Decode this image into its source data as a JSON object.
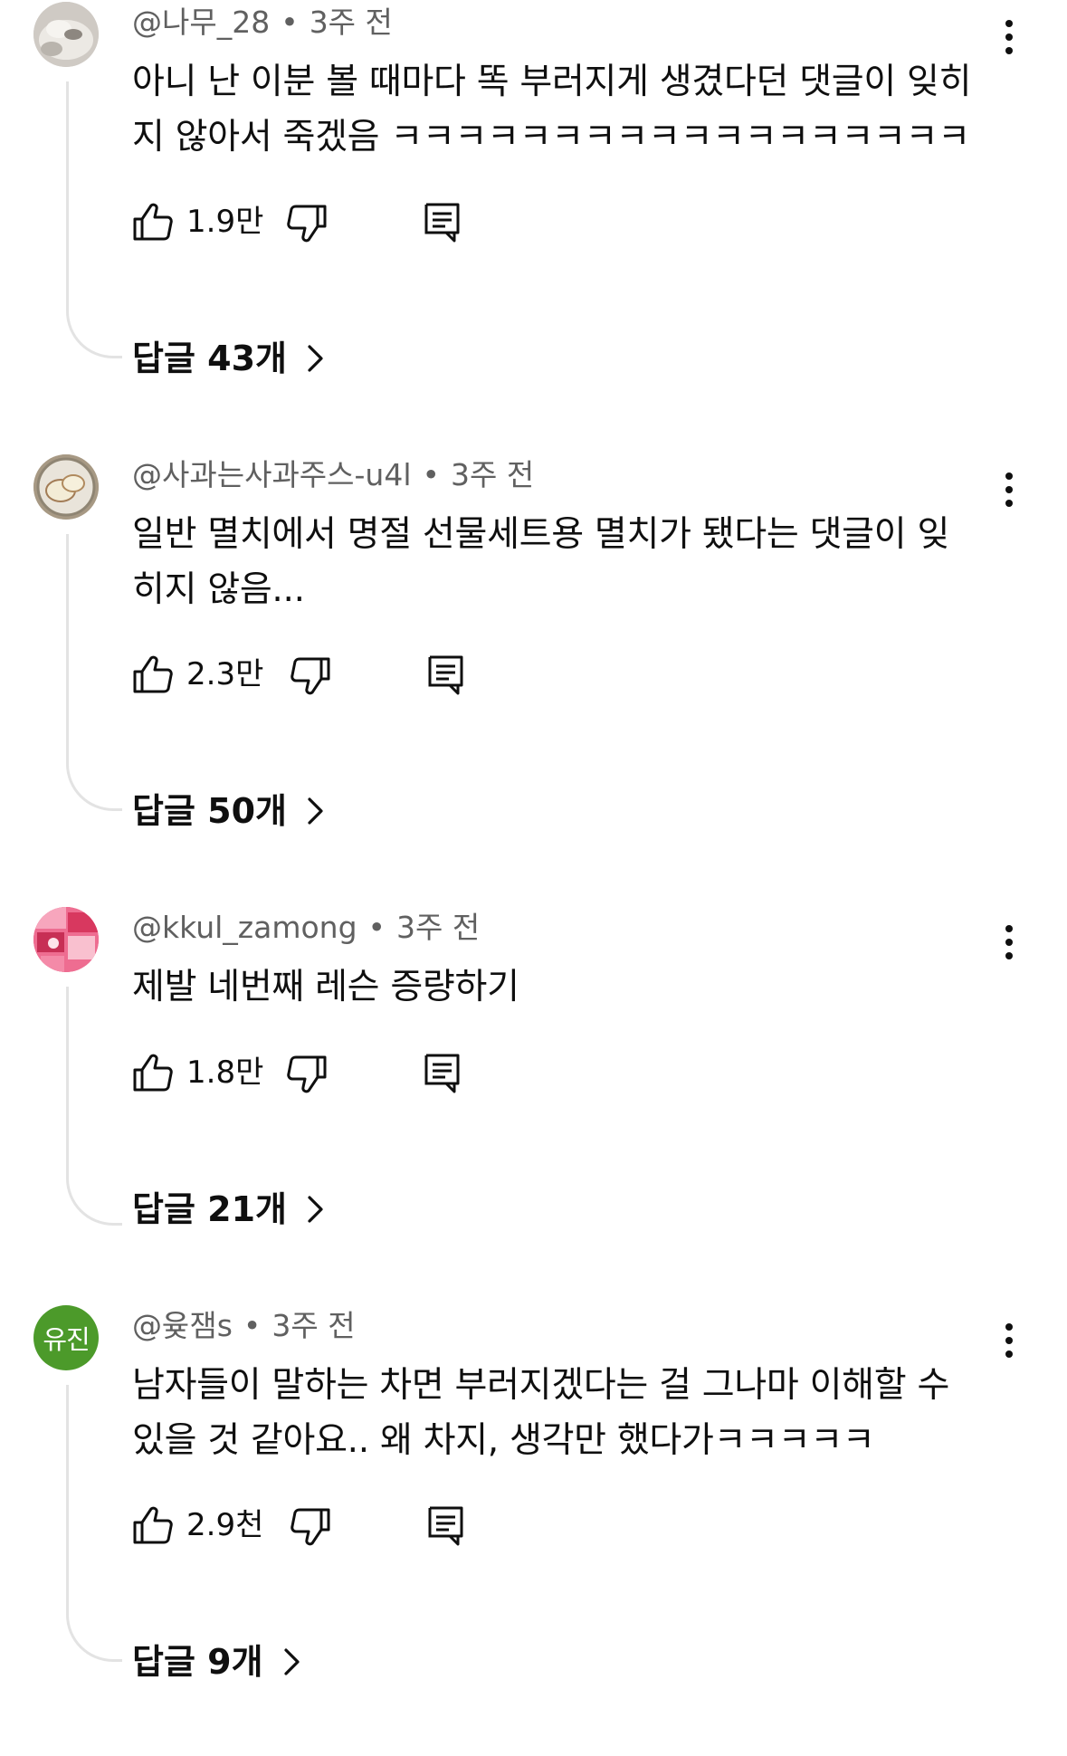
{
  "comments": [
    {
      "author": "@나무_28",
      "time": "3주 전",
      "text_lines": [
        "아니 난 이분 볼 때마다 똑 부러지게 생겼다던 댓글이 잊히",
        "지 않아서 죽겠음 ㅋㅋㅋㅋㅋㅋㅋㅋㅋㅋㅋㅋㅋㅋㅋㅋㅋㅋ"
      ],
      "likes": "1.9만",
      "replies_label": "답글 43개",
      "avatar_icon": "sleeping-cat-photo"
    },
    {
      "author": "@사과는사과주스-u4l",
      "time": "3주 전",
      "text_lines": [
        "일반 멸치에서 명절 선물세트용 멸치가 됐다는 댓글이 잊",
        "히지 않음..."
      ],
      "likes": "2.3만",
      "replies_label": "답글 50개",
      "avatar_icon": "apple-slices-photo"
    },
    {
      "author": "@kkul_zamong",
      "time": "3주 전",
      "text_lines": [
        "제발 네번째 레슨 증량하기"
      ],
      "likes": "1.8만",
      "replies_label": "답글 21개",
      "avatar_icon": "pink-collage-photo"
    },
    {
      "author": "@윶잼s",
      "time": "3주 전",
      "text_lines": [
        "남자들이 말하는 차면 부러지겠다는 걸 그나마 이해할 수",
        "있을 것 같아요.. 왜 차지, 생각만 했다가ㅋㅋㅋㅋㅋ"
      ],
      "likes": "2.9천",
      "replies_label": "답글 9개",
      "avatar_initials": "유진",
      "avatar_color": "#4c9a2a"
    }
  ],
  "icons": {
    "like": "thumbs-up-outline-icon",
    "dislike": "thumbs-down-outline-icon",
    "reply": "comment-reply-icon",
    "more": "vertical-dots-icon",
    "chevron": "chevron-right-icon"
  }
}
